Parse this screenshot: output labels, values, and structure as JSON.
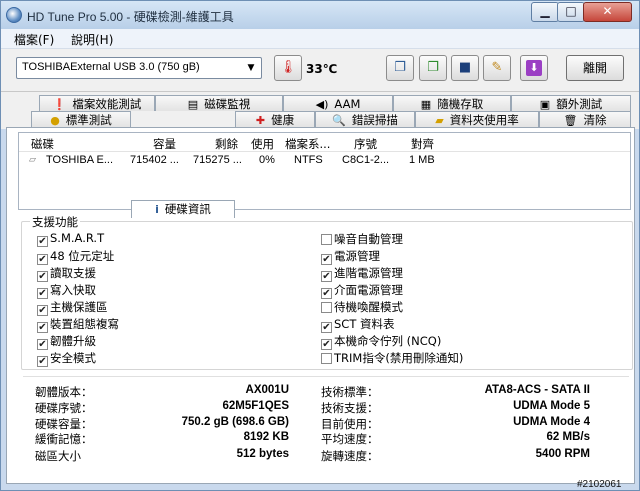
{
  "window": {
    "title": "HD Tune Pro  5.00 - 硬碟檢測-維護工具",
    "min_glyph": "▁",
    "max_glyph": "□",
    "close_glyph": "✕"
  },
  "menu": {
    "items": [
      "檔案(F)",
      "說明(H)"
    ]
  },
  "toolbar": {
    "drive_selected": "TOSHIBAExternal USB 3.0 (750 gB)",
    "temperature": "33℃",
    "exit_label": "離開",
    "icons": [
      "copy-icon",
      "save-screenshot-icon",
      "save-icon",
      "wrench-icon",
      "download-icon"
    ]
  },
  "tabs": {
    "row1": [
      "檔案效能測試",
      "磁碟監視",
      "AAM",
      "隨機存取",
      "額外測試"
    ],
    "row2": [
      "標準測試",
      "硬碟資訊",
      "健康",
      "錯誤掃描",
      "資料夾使用率",
      "清除"
    ],
    "active": "硬碟資訊"
  },
  "volumes": {
    "headers": [
      "磁碟",
      "容量",
      "剩餘",
      "使用",
      "檔案系...",
      "序號",
      "對齊"
    ],
    "rows": [
      [
        "TOSHIBA E...",
        "715402 ...",
        "715275 ...",
        "0%",
        "NTFS",
        "C8C1-2...",
        "1 MB"
      ]
    ]
  },
  "features": {
    "title": "支援功能",
    "left": [
      {
        "label": "S.M.A.R.T",
        "checked": true
      },
      {
        "label": "48 位元定址",
        "checked": true
      },
      {
        "label": "讀取支援",
        "checked": true
      },
      {
        "label": "寫入快取",
        "checked": true
      },
      {
        "label": "主機保護區",
        "checked": true
      },
      {
        "label": "裝置組態複寫",
        "checked": true
      },
      {
        "label": "韌體升級",
        "checked": true
      },
      {
        "label": "安全模式",
        "checked": true
      }
    ],
    "right": [
      {
        "label": "噪音自動管理",
        "checked": false
      },
      {
        "label": "電源管理",
        "checked": true
      },
      {
        "label": "進階電源管理",
        "checked": true
      },
      {
        "label": "介面電源管理",
        "checked": true
      },
      {
        "label": "待機喚醒模式",
        "checked": false
      },
      {
        "label": "SCT 資料表",
        "checked": true
      },
      {
        "label": "本機命令佇列 (NCQ)",
        "checked": true
      },
      {
        "label": "TRIM指令(禁用刪除通知)",
        "checked": false
      }
    ]
  },
  "details": {
    "left": [
      {
        "label": "韌體版本：",
        "value": "AX001U"
      },
      {
        "label": "硬碟序號：",
        "value": "62M5F1QES"
      },
      {
        "label": "硬碟容量：",
        "value": "750.2 gB (698.6 GB)"
      },
      {
        "label": "緩衝記憶：",
        "value": "8192 KB"
      },
      {
        "label": "磁區大小",
        "value": "512 bytes"
      }
    ],
    "right": [
      {
        "label": "技術標準：",
        "value": "ATA8-ACS - SATA II"
      },
      {
        "label": "技術支援：",
        "value": "UDMA Mode 5"
      },
      {
        "label": "目前使用：",
        "value": "UDMA Mode 4"
      },
      {
        "label": "平均速度：",
        "value": "62 MB/s"
      },
      {
        "label": "旋轉速度：",
        "value": "5400 RPM"
      }
    ]
  },
  "watermark": "#2102061"
}
